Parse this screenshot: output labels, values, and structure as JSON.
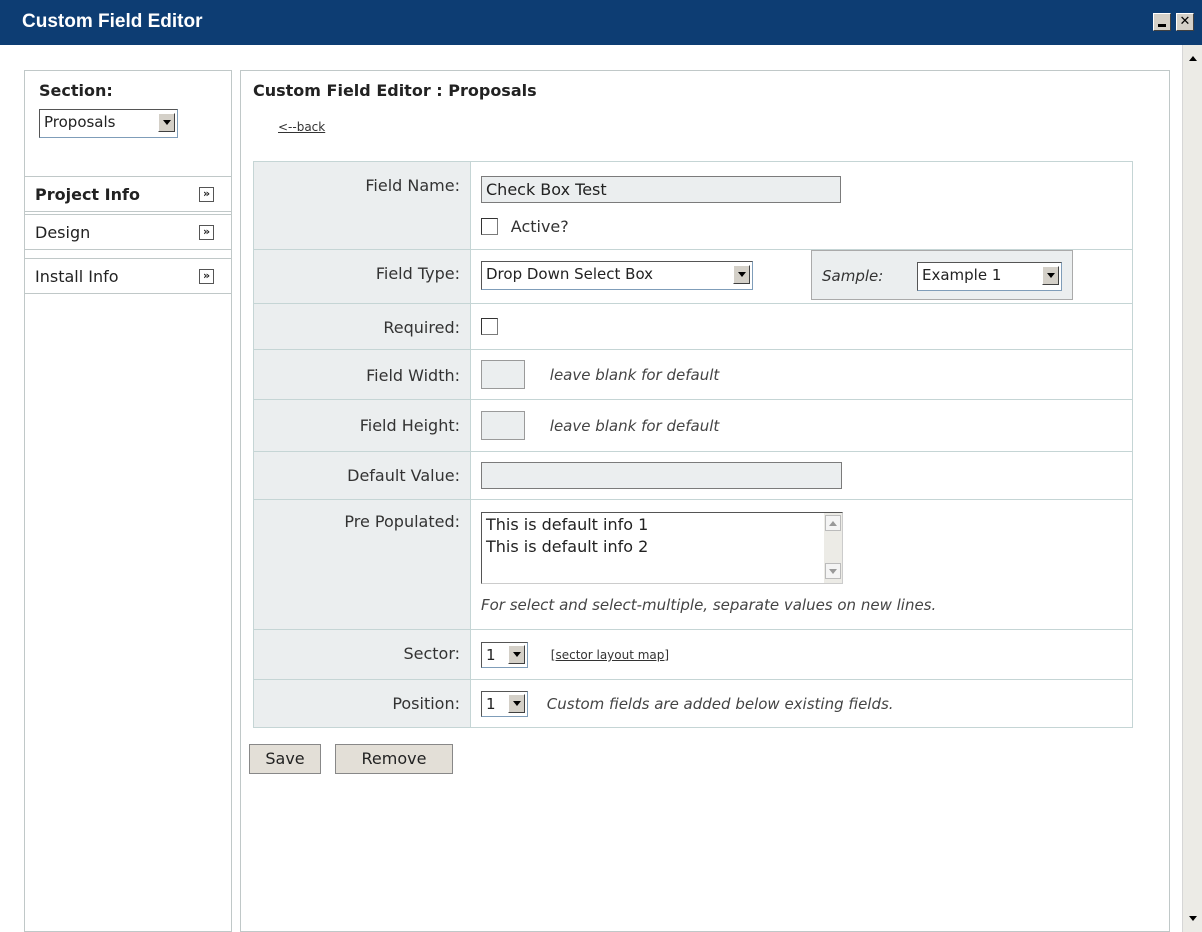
{
  "window": {
    "title": "Custom Field Editor",
    "close_glyph": "✕"
  },
  "sidebar": {
    "section_label": "Section:",
    "section_value": "Proposals",
    "items": [
      {
        "label": "Project Info",
        "active": true
      },
      {
        "label": "Design",
        "active": false
      },
      {
        "label": "Install Info",
        "active": false
      }
    ],
    "chevron_glyph": "»"
  },
  "main": {
    "title": "Custom Field Editor : Proposals",
    "back_link": "<--back",
    "form": {
      "field_name_label": "Field Name:",
      "field_name_value": "Check Box Test",
      "active_label": "Active?",
      "active_checked": false,
      "field_type_label": "Field Type:",
      "field_type_value": "Drop Down Select Box",
      "sample_label": "Sample:",
      "sample_value": "Example 1",
      "required_label": "Required:",
      "required_checked": false,
      "field_width_label": "Field Width:",
      "field_width_hint": "leave blank for default",
      "field_height_label": "Field Height:",
      "field_height_hint": "leave blank for default",
      "default_value_label": "Default Value:",
      "default_value_value": "",
      "pre_populated_label": "Pre Populated:",
      "pre_populated_lines": [
        "This is default info 1",
        "This is default info 2"
      ],
      "pre_populated_hint": "For select and select-multiple, separate values on new lines.",
      "sector_label": "Sector:",
      "sector_value": "1",
      "sector_link": "[sector layout map]",
      "position_label": "Position:",
      "position_value": "1",
      "position_hint": "Custom fields are added below existing fields."
    },
    "buttons": {
      "save": "Save",
      "remove": "Remove"
    }
  }
}
